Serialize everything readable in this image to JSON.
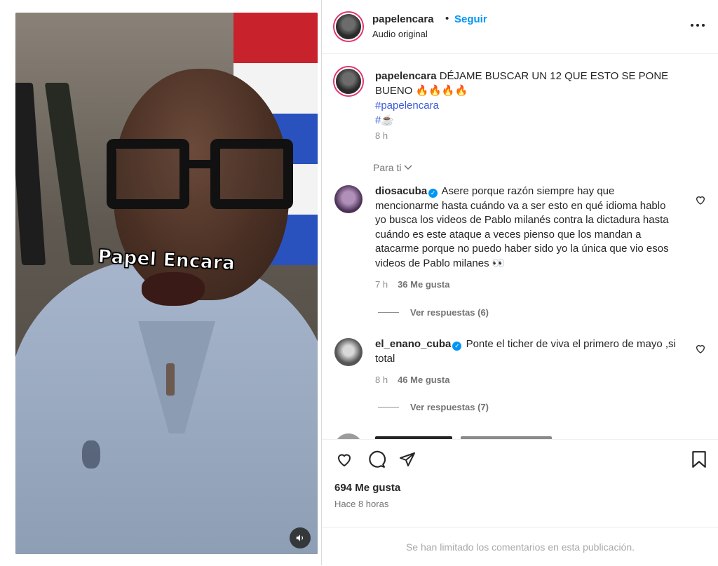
{
  "video": {
    "caption_overlay": "Papel Encara",
    "mute_icon": "speaker-icon"
  },
  "header": {
    "username": "papelencara",
    "separator": "•",
    "follow_label": "Seguir",
    "audio_label": "Audio original"
  },
  "post_caption": {
    "username": "papelencara",
    "text": "DÉJAME BUSCAR UN 12 QUE ESTO SE PONE BUENO 🔥🔥🔥🔥",
    "hashtag": "#papelencara",
    "hashtag2": "#☕️",
    "time": "8 h"
  },
  "sort_label": "Para ti",
  "comments": [
    {
      "username": "diosacuba",
      "verified": true,
      "text": "Asere porque razón siempre hay que mencionarme hasta cuándo va a ser esto en qué idioma hablo yo busca los videos de Pablo milanés contra la dictadura hasta cuándo es este ataque a veces pienso que los mandan a atacarme porque no puedo haber sido yo la única que vio esos videos de Pablo milanes 👀",
      "time": "7 h",
      "likes": "36 Me gusta",
      "replies": "Ver respuestas (6)"
    },
    {
      "username": "el_enano_cuba",
      "verified": true,
      "text": "Ponte el ticher de viva el primero de mayo ,si total",
      "time": "8 h",
      "likes": "46 Me gusta",
      "replies": "Ver respuestas (7)"
    }
  ],
  "footer": {
    "likes": "694 Me gusta",
    "ago": "Hace 8 horas",
    "limited": "Se han limitado los comentarios en esta publicación."
  },
  "colors": {
    "accent": "#0095f6",
    "hashtag": "#3b5bd6",
    "muted": "#8e8e8e"
  }
}
